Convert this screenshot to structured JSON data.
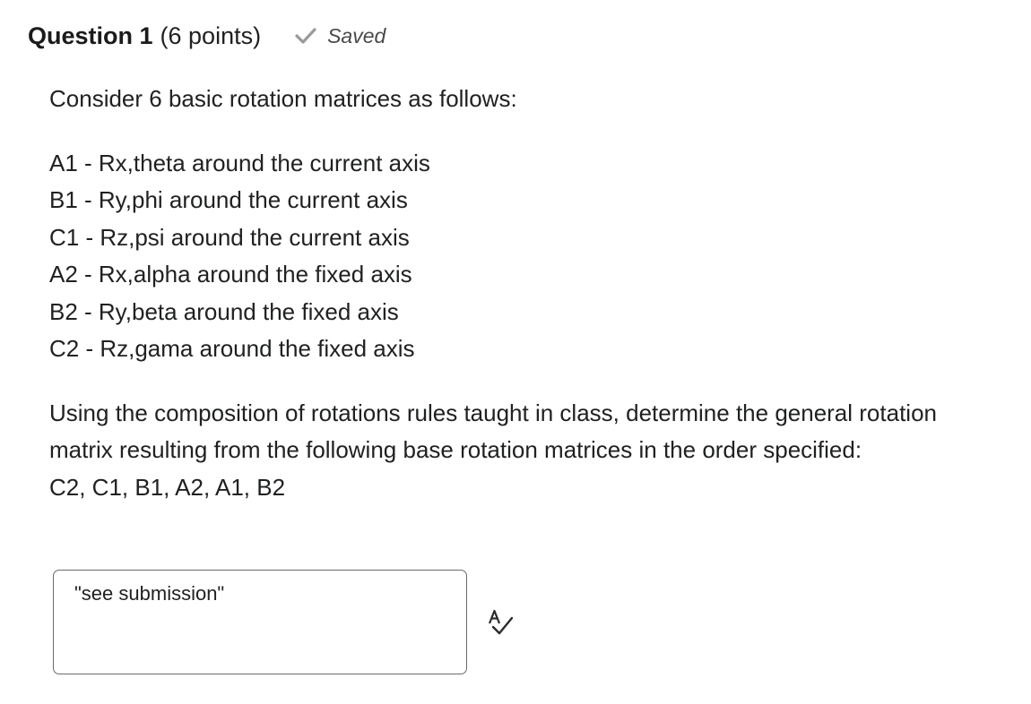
{
  "question": {
    "title": "Question 1",
    "points": "(6 points)",
    "saved_label": "Saved"
  },
  "body": {
    "intro": "Consider 6 basic rotation matrices as follows:",
    "matrices": [
      "A1 - Rx,theta around the current axis",
      "B1 - Ry,phi around the current axis",
      "C1 - Rz,psi around the current axis",
      "A2 - Rx,alpha around the fixed axis",
      "B2 - Ry,beta around the fixed axis",
      "C2 - Rz,gama around the fixed axis"
    ],
    "instructions": "Using the composition of rotations rules taught in class, determine the general rotation matrix resulting from the following base rotation matrices in the order specified:",
    "order": "C2, C1, B1, A2, A1, B2"
  },
  "answer": {
    "value": "\"see submission\""
  },
  "icons": {
    "saved": "check-icon",
    "spellcheck": "spellcheck-icon"
  },
  "colors": {
    "text": "#202122",
    "saved_check": "#9a9a9a",
    "border": "#6b6b6b"
  }
}
